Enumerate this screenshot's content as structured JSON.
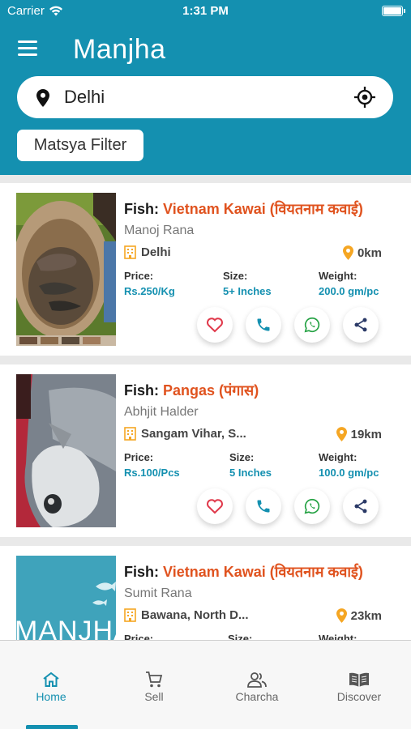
{
  "status_bar": {
    "carrier": "Carrier",
    "time": "1:31 PM"
  },
  "header": {
    "title": "Manjha",
    "menu_icon": "hamburger-icon"
  },
  "search": {
    "location": "Delhi",
    "pin_icon": "location-pin-icon",
    "gps_icon": "crosshair-icon"
  },
  "filter": {
    "label": "Matsya Filter"
  },
  "listings": [
    {
      "fish_label": "Fish:",
      "fish_name": "Vietnam Kawai (वियतनाम कवाई)",
      "seller": "Manoj Rana",
      "place": "Delhi",
      "distance": "0km",
      "price_label": "Price:",
      "price": "Rs.250/Kg",
      "size_label": "Size:",
      "size": "5+ Inches",
      "weight_label": "Weight:",
      "weight": "200.0 gm/pc"
    },
    {
      "fish_label": "Fish:",
      "fish_name": "Pangas (पंगास)",
      "seller": "Abhjit Halder",
      "place": "Sangam Vihar, S...",
      "distance": "19km",
      "price_label": "Price:",
      "price": "Rs.100/Pcs",
      "size_label": "Size:",
      "size": "5 Inches",
      "weight_label": "Weight:",
      "weight": "100.0 gm/pc"
    },
    {
      "fish_label": "Fish:",
      "fish_name": "Vietnam Kawai (वियतनाम कवाई)",
      "seller": "Sumit Rana",
      "place": "Bawana, North D...",
      "distance": "23km",
      "price_label": "Price:",
      "price": "",
      "size_label": "Size:",
      "size": "",
      "weight_label": "Weight:",
      "weight": ""
    }
  ],
  "placeholder_logo_text": "MANJHA",
  "bottom_nav": [
    {
      "label": "Home",
      "icon": "home-icon",
      "active": true
    },
    {
      "label": "Sell",
      "icon": "cart-icon",
      "active": false
    },
    {
      "label": "Charcha",
      "icon": "people-icon",
      "active": false
    },
    {
      "label": "Discover",
      "icon": "book-icon",
      "active": false
    }
  ],
  "colors": {
    "primary": "#1490b0",
    "accent": "#e0531f",
    "location": "#f5a623",
    "heart": "#e0394b",
    "whatsapp": "#25a244",
    "share": "#2b3a67"
  }
}
